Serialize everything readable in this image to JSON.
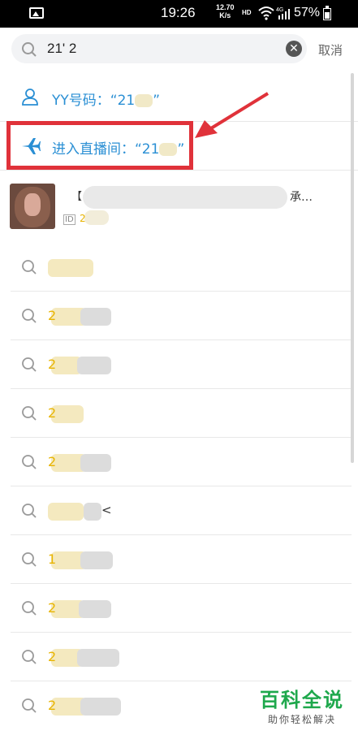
{
  "status_bar": {
    "time": "19:26",
    "speed_value": "12.70",
    "speed_unit": "K/s",
    "hd": "HD",
    "signal": "4G",
    "battery": "57%"
  },
  "search": {
    "value": "21' 2",
    "cancel": "取消"
  },
  "suggestions": {
    "yy_label": "YY号码：“21",
    "yy_tail": "”",
    "live_label": "进入直播间：“21",
    "live_tail": "”"
  },
  "user_card": {
    "name_lead": "【",
    "name_tail": "承…",
    "id_badge": "ID",
    "id_value": "2"
  },
  "history": [
    {
      "text": "",
      "tail": ""
    },
    {
      "text": "2",
      "tail": ""
    },
    {
      "text": "2",
      "tail": ""
    },
    {
      "text": "2",
      "tail": ""
    },
    {
      "text": "2",
      "tail": ""
    },
    {
      "text": "",
      "tail": "<"
    },
    {
      "text": "1",
      "tail": ""
    },
    {
      "text": "2",
      "tail": ""
    },
    {
      "text": "2",
      "tail": ""
    },
    {
      "text": "2",
      "tail": ""
    }
  ],
  "watermark": {
    "title": "百科全说",
    "subtitle": "助你轻松解决"
  },
  "colors": {
    "accent_blue": "#2a8fd4",
    "highlight_yellow": "#e8b400",
    "annotation_red": "#e0323a",
    "watermark_green": "#1ea84c"
  },
  "icons": [
    "image-icon",
    "wifi-icon",
    "signal-icon",
    "battery-icon",
    "search-icon",
    "clear-icon",
    "user-icon",
    "plane-icon",
    "history-search-icon"
  ]
}
